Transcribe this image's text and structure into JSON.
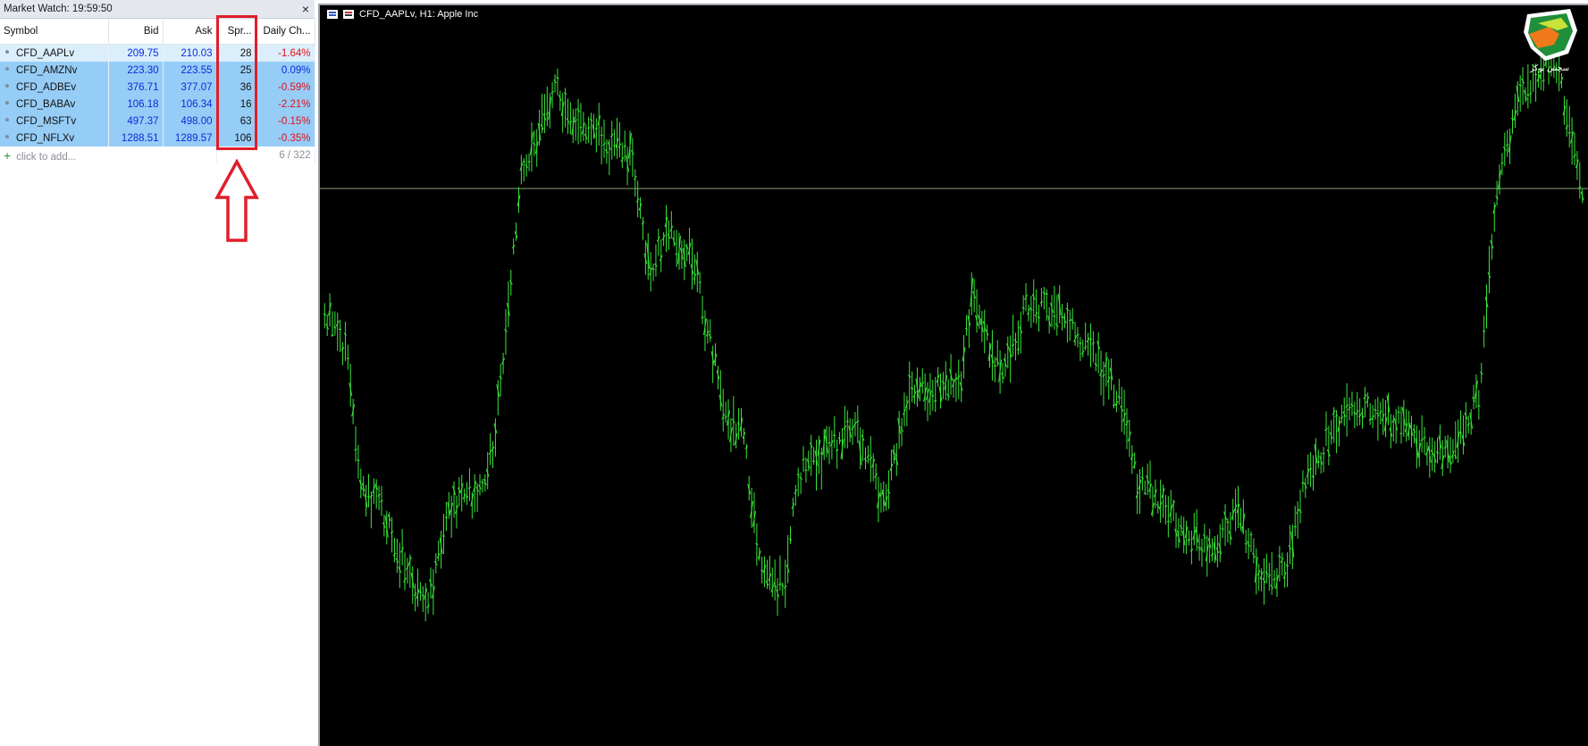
{
  "market_watch": {
    "title": "Market Watch: 19:59:50",
    "close_icon": "×",
    "columns": [
      "Symbol",
      "Bid",
      "Ask",
      "Spr...",
      "Daily Ch..."
    ],
    "rows": [
      {
        "symbol": "CFD_AAPLv",
        "bid": "209.75",
        "ask": "210.03",
        "spread": "28",
        "daily_change": "-1.64%"
      },
      {
        "symbol": "CFD_AMZNv",
        "bid": "223.30",
        "ask": "223.55",
        "spread": "25",
        "daily_change": "0.09%"
      },
      {
        "symbol": "CFD_ADBEv",
        "bid": "376.71",
        "ask": "377.07",
        "spread": "36",
        "daily_change": "-0.59%"
      },
      {
        "symbol": "CFD_BABAv",
        "bid": "106.18",
        "ask": "106.34",
        "spread": "16",
        "daily_change": "-2.21%"
      },
      {
        "symbol": "CFD_MSFTv",
        "bid": "497.37",
        "ask": "498.00",
        "spread": "63",
        "daily_change": "-0.15%"
      },
      {
        "symbol": "CFD_NFLXv",
        "bid": "1288.51",
        "ask": "1289.57",
        "spread": "106",
        "daily_change": "-0.35%"
      }
    ],
    "add_label": "click to add...",
    "count": "6 / 322"
  },
  "chart": {
    "title": "CFD_AAPLv, H1:  Apple Inc",
    "bar_color": "#39e639",
    "background": "#000000",
    "logo_text": "سچس بوکر"
  },
  "annotation": {
    "color": "#e11d2a",
    "target": "Spread column"
  }
}
